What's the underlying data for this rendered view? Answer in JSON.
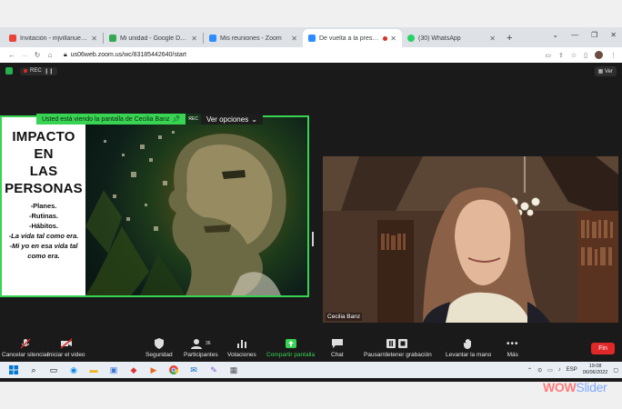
{
  "browser": {
    "tabs": [
      {
        "label": "Invitación - mjvillanueva@cc",
        "favicon_color": "#ea4335"
      },
      {
        "label": "Mi unidad - Google Drive",
        "favicon_color": "#34a853"
      },
      {
        "label": "Mis reuniones - Zoom",
        "favicon_color": "#2d8cff"
      },
      {
        "label": "De vuelta a la presencialid",
        "favicon_color": "#2d8cff",
        "active": true
      },
      {
        "label": "(30) WhatsApp",
        "favicon_color": "#25d366"
      }
    ],
    "new_tab": "+",
    "url": "us06web.zoom.us/wc/83185442640/start",
    "window_controls": [
      "⌄",
      "—",
      "❐",
      "✕"
    ]
  },
  "zoom": {
    "rec_label": "REC",
    "rec_time": "11",
    "view_button": "Ver",
    "share_notice": "Usted está viendo la pantalla de Cecilia Banz",
    "share_rec": "REC",
    "view_options": "Ver opciones",
    "presenter_name": "Cecilia Banz",
    "slide": {
      "title_lines": [
        "IMPACTO",
        "EN",
        "LAS",
        "PERSONAS"
      ],
      "bullets": [
        "-Planes.",
        "-Rutinas.",
        "-Hábitos."
      ],
      "italic_bullets": [
        "-La vida tal como era.",
        "-Mi yo en esa vida tal como era."
      ]
    },
    "controls": [
      {
        "label": "Cancelar silenciar",
        "icon": "mic-muted-icon"
      },
      {
        "label": "Iniciar el video",
        "icon": "video-off-icon"
      },
      {
        "label": "Seguridad",
        "icon": "shield-icon"
      },
      {
        "label": "Participantes",
        "icon": "participants-icon",
        "count": "36"
      },
      {
        "label": "Votaciones",
        "icon": "poll-icon"
      },
      {
        "label": "Compartir pantalla",
        "icon": "share-screen-icon",
        "color": "#39d353"
      },
      {
        "label": "Chat",
        "icon": "chat-icon"
      },
      {
        "label": "Pausar/detener grabación",
        "icon": "pause-record-icon"
      },
      {
        "label": "Levantar la mano",
        "icon": "raise-hand-icon"
      },
      {
        "label": "Más",
        "icon": "more-icon"
      }
    ],
    "end_button": "Fin"
  },
  "taskbar": {
    "lang": "ESP",
    "time": "19:08",
    "date": "06/06/2022"
  },
  "watermark": {
    "part1": "WOW",
    "part2": "Slider"
  }
}
